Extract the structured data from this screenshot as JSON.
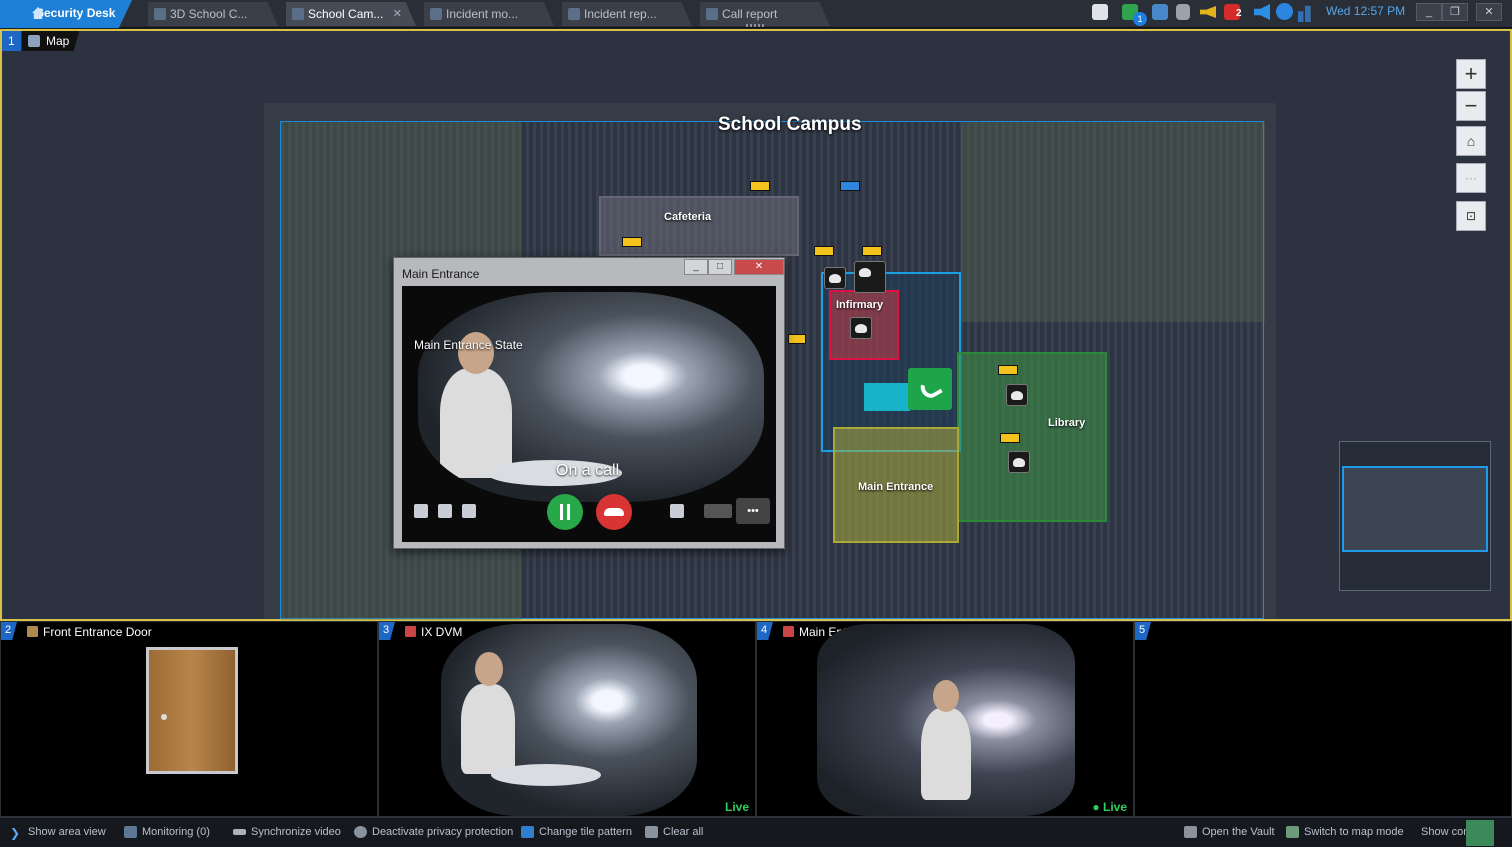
{
  "app": {
    "home_tab": "Security Desk",
    "tabs": [
      {
        "label": "3D School C..."
      },
      {
        "label": "School Cam..."
      },
      {
        "label": "Incident mo..."
      },
      {
        "label": "Incident rep..."
      },
      {
        "label": "Call report"
      }
    ],
    "tab_close": "✕",
    "clock": "Wed 12:57 PM",
    "tray_badges": {
      "calls": "1",
      "alarms": "2"
    }
  },
  "map_tile": {
    "tile_number": "1",
    "label": "Map",
    "campus_title": "School Campus",
    "zones": {
      "cafeteria": "Cafeteria",
      "infirmary": "Infirmary",
      "library": "Library",
      "main_entrance": "Main Entrance"
    },
    "zoom_in": "+",
    "zoom_out": "−",
    "more": "···"
  },
  "call_window": {
    "title": "Main Entrance",
    "video_caption": "Main Entrance State",
    "status": "On a call",
    "controls": {
      "min": "_",
      "max": "□",
      "close": "✕",
      "more": "•••"
    }
  },
  "tiles": [
    {
      "number": "2",
      "name": "Front Entrance Door",
      "live": ""
    },
    {
      "number": "3",
      "name": "IX DVM",
      "live": "Live"
    },
    {
      "number": "4",
      "name": "Main Entrance",
      "live": "● Live"
    },
    {
      "number": "5",
      "name": "",
      "live": ""
    }
  ],
  "bottom_bar": {
    "show_area_view": "Show area view",
    "monitoring": "Monitoring (0)",
    "sync_video": "Synchronize video",
    "privacy": "Deactivate privacy protection",
    "tile_pattern": "Change tile pattern",
    "clear_all": "Clear all",
    "open_vault": "Open the Vault",
    "map_mode": "Switch to map mode",
    "show_controls": "Show contr"
  },
  "colors": {
    "accent": "#1d7fd6",
    "map_border": "#d6c24a",
    "live": "#2fd05a",
    "call_accept": "#29a84a",
    "call_end": "#d93434"
  }
}
